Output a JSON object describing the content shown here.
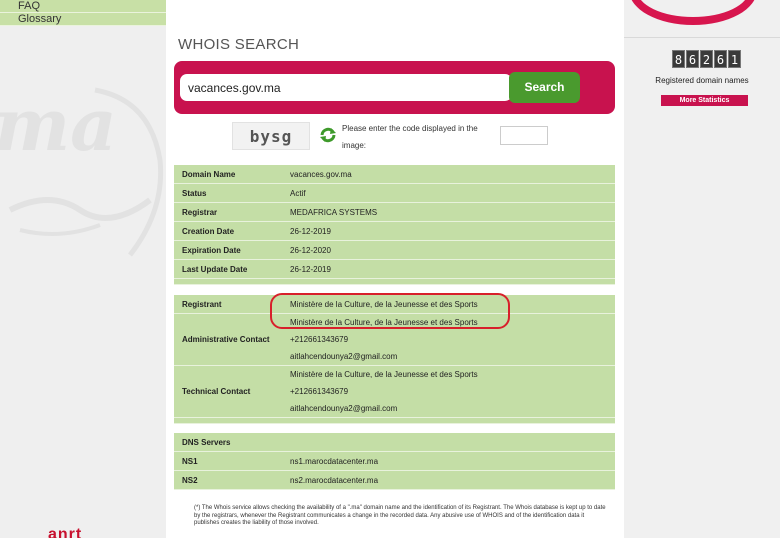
{
  "nav": {
    "items": [
      {
        "label": "FAQ"
      },
      {
        "label": "Glossary"
      }
    ]
  },
  "header": {
    "title": "WHOIS SEARCH"
  },
  "search": {
    "value": "vacances.gov.ma",
    "button_label": "Search"
  },
  "captcha": {
    "code": "bysg",
    "prompt": "Please enter the code displayed in the image:"
  },
  "domain_info": {
    "rows": [
      {
        "label": "Domain Name",
        "value": "vacances.gov.ma"
      },
      {
        "label": "Status",
        "value": "Actif"
      },
      {
        "label": "Registrar",
        "value": "MEDAFRICA SYSTEMS"
      },
      {
        "label": "Creation Date",
        "value": "26-12-2019"
      },
      {
        "label": "Expiration Date",
        "value": "26-12-2020"
      },
      {
        "label": "Last Update Date",
        "value": "26-12-2019"
      }
    ]
  },
  "contacts": {
    "registrant": {
      "label": "Registrant",
      "name": "Ministère de la Culture, de la Jeunesse et des Sports"
    },
    "administrative": {
      "label": "Administrative Contact",
      "name": "Ministère de la Culture, de la Jeunesse et des Sports",
      "phone": "+212661343679",
      "email": "aitlahcendounya2@gmail.com"
    },
    "technical": {
      "label": "Technical Contact",
      "name": "Ministère de la Culture, de la Jeunesse et des Sports",
      "phone": "+212661343679",
      "email": "aitlahcendounya2@gmail.com"
    }
  },
  "dns": {
    "header": "DNS Servers",
    "servers": [
      {
        "label": "NS1",
        "value": "ns1.marocdatacenter.ma"
      },
      {
        "label": "NS2",
        "value": "ns2.marocdatacenter.ma"
      }
    ]
  },
  "footnote": "(*) The Whois service allows checking the availability of a \".ma\" domain name and the identification of its Registrant. The Whois database is kept up to date by the registrars, whenever the Registrant communicates a change in the recorded data. Any abusive use of WHOIS and of the identification data it publishes creates the liability of those involved.",
  "stats": {
    "digits": [
      "8",
      "6",
      "2",
      "6",
      "1"
    ],
    "label": "Registered domain names",
    "more_label": "More Statistics"
  },
  "brand": {
    "bottom_logo": "anrt"
  },
  "colors": {
    "accent": "#c8124e",
    "button_green": "#4a9a2e",
    "table_green": "#c4dea6",
    "annotation_red": "#d8202b"
  }
}
